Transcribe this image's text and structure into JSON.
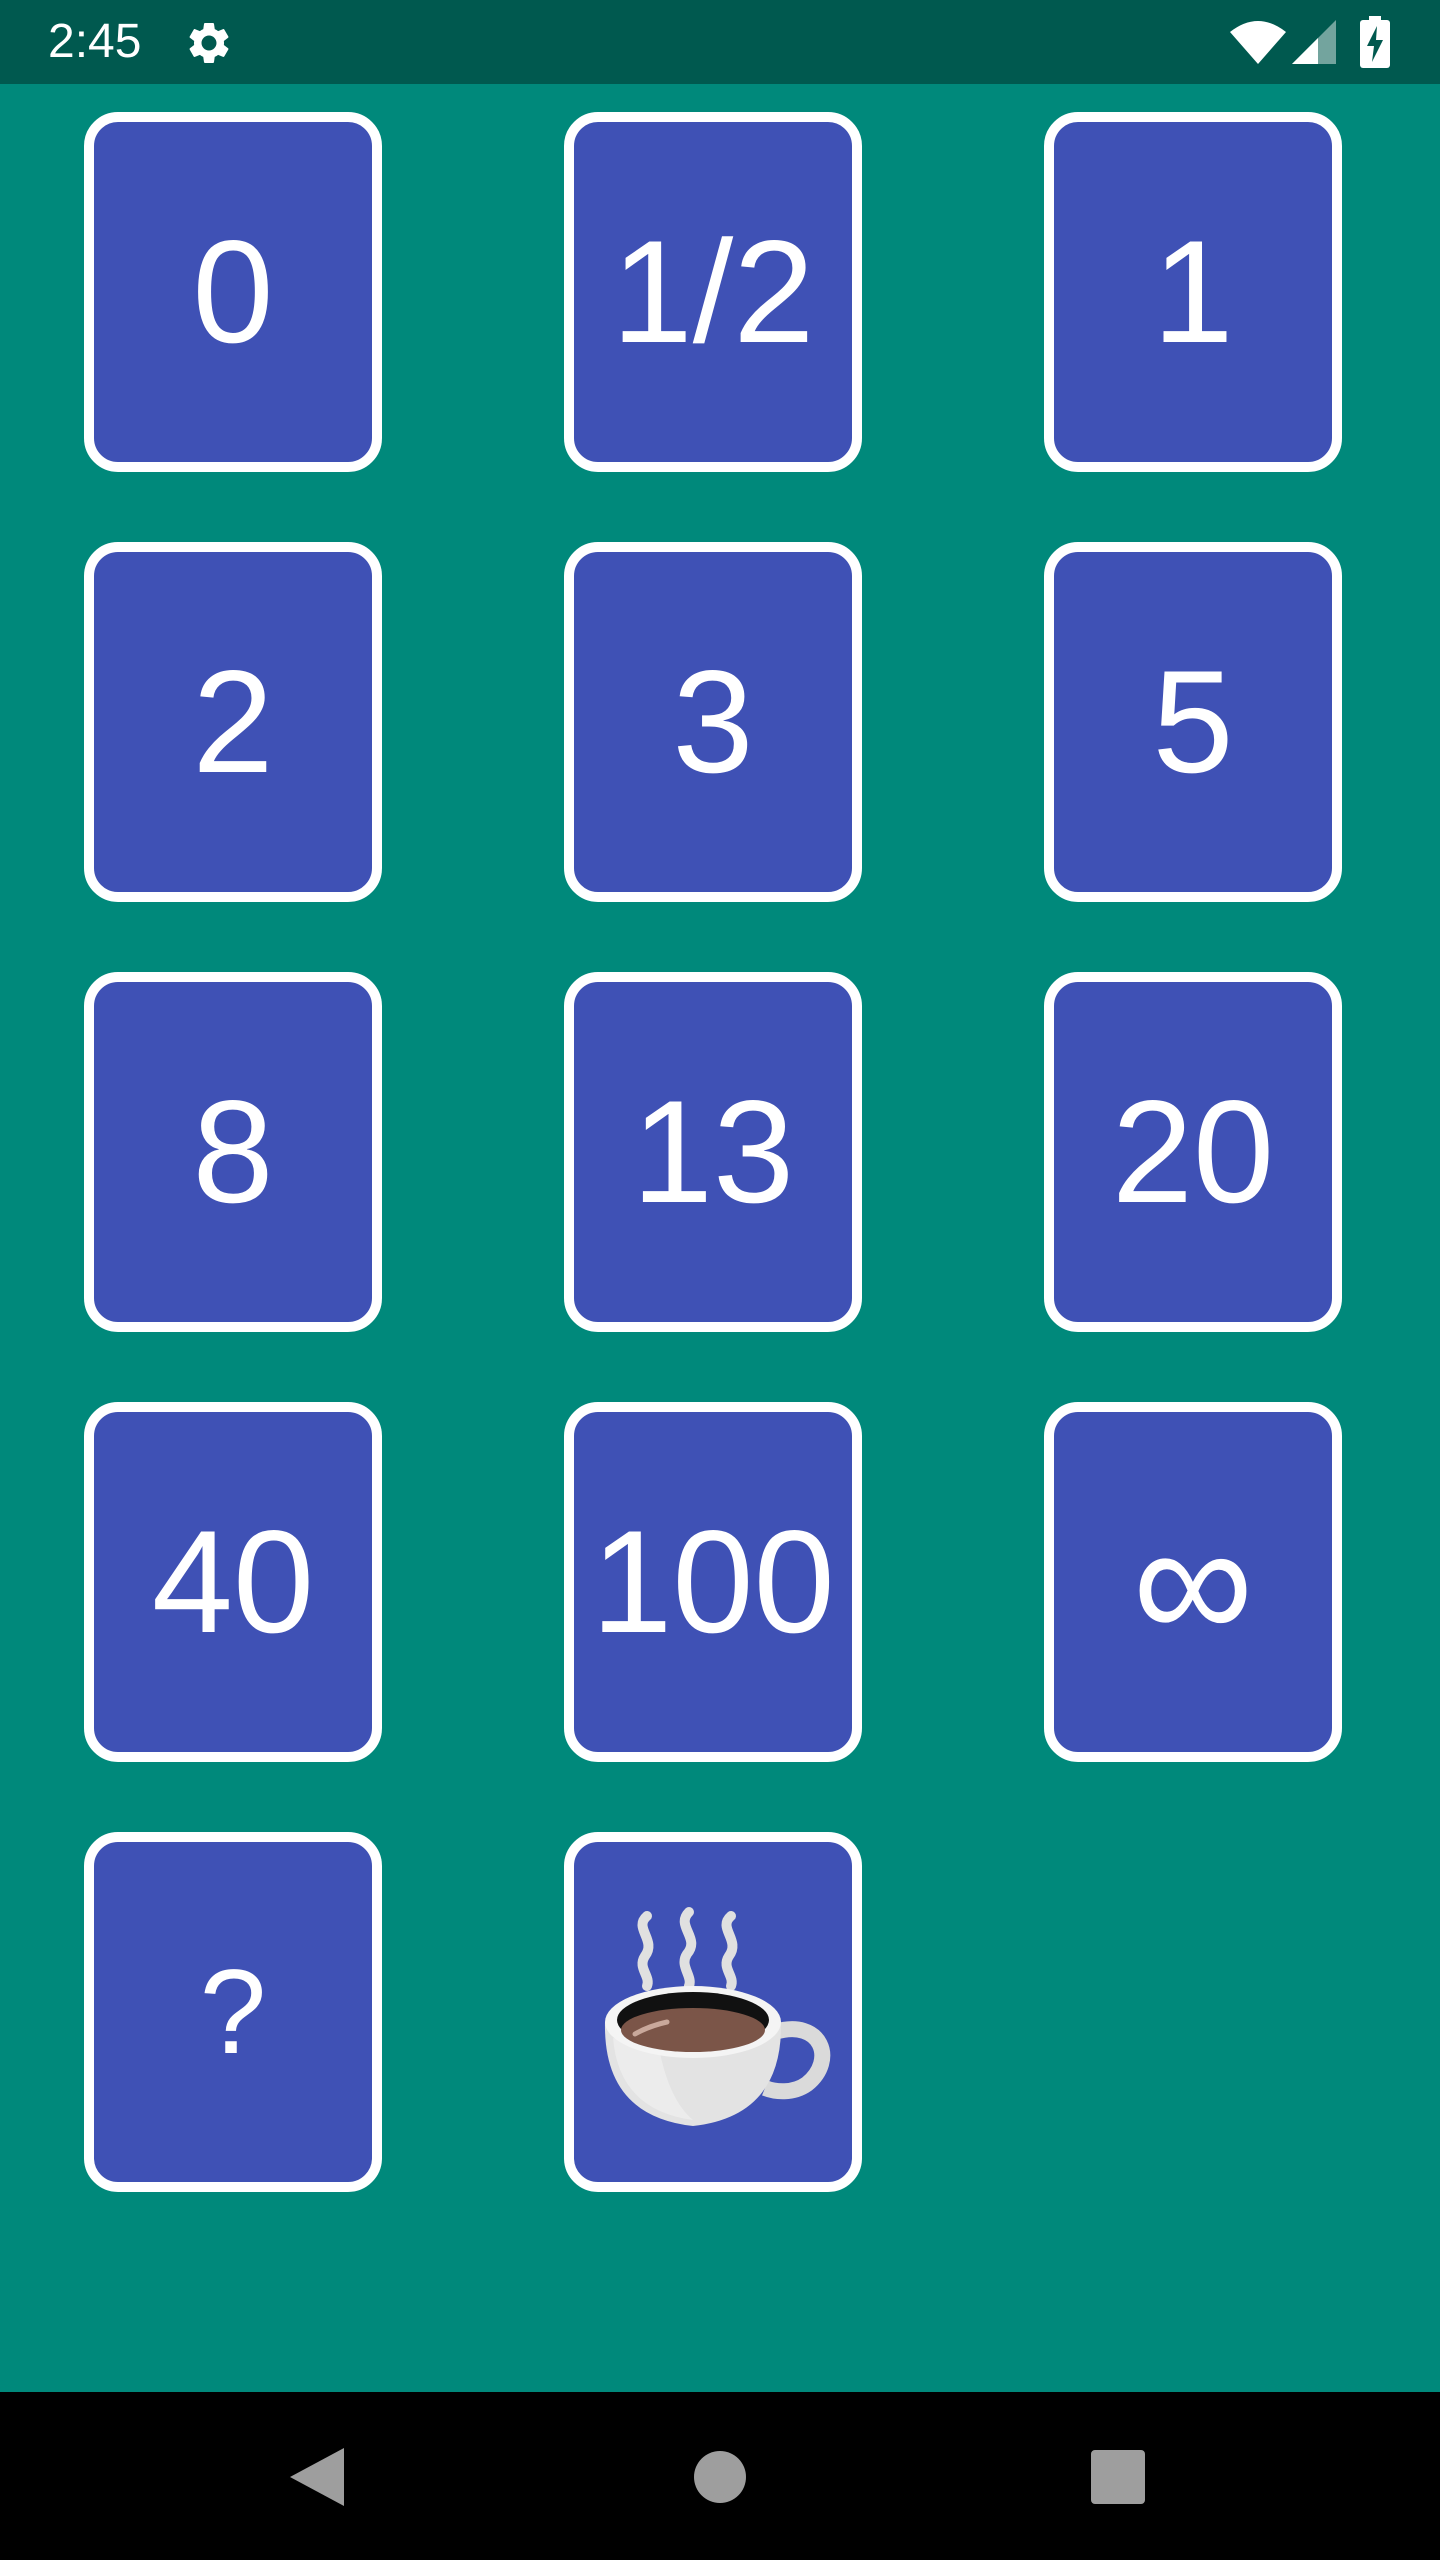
{
  "status_bar": {
    "time": "2:45",
    "icons": [
      "gear-icon",
      "wifi-icon",
      "signal-icon",
      "battery-charging-icon"
    ]
  },
  "cards": [
    {
      "label": "0"
    },
    {
      "label": "1/2"
    },
    {
      "label": "1"
    },
    {
      "label": "2"
    },
    {
      "label": "3"
    },
    {
      "label": "5"
    },
    {
      "label": "8"
    },
    {
      "label": "13"
    },
    {
      "label": "20"
    },
    {
      "label": "40"
    },
    {
      "label": "100"
    },
    {
      "label": "∞"
    },
    {
      "label": "?"
    },
    {
      "label": "",
      "icon": "coffee-cup-icon"
    }
  ],
  "nav_bar": {
    "buttons": [
      "back-icon",
      "home-icon",
      "recents-icon"
    ]
  },
  "colors": {
    "background": "#00897B",
    "status_bar": "#00594F",
    "card": "#3F51B5",
    "card_border": "#FFFFFF",
    "nav_bar": "#000000"
  }
}
